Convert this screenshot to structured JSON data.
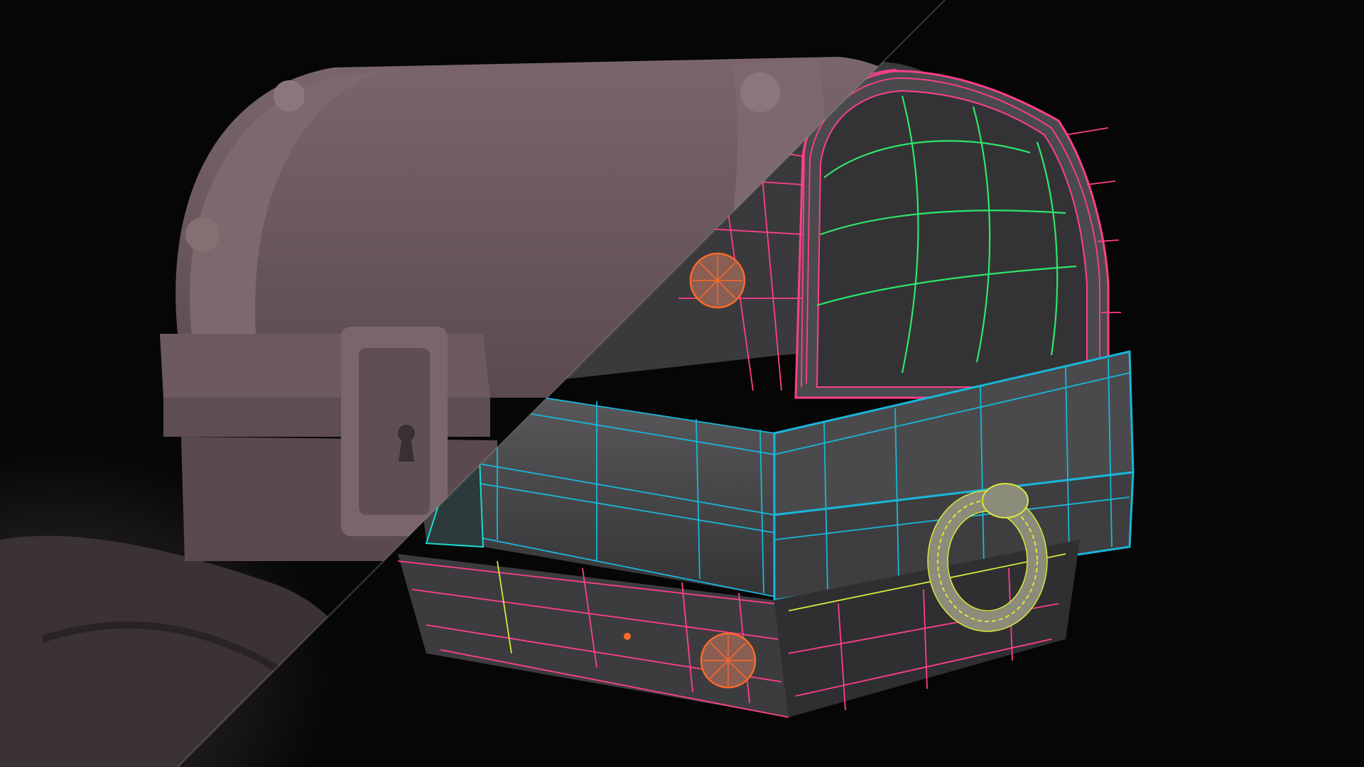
{
  "scene": {
    "subject": "treasure-chest",
    "render_halves": [
      "clay-render",
      "wireframe-topology-render"
    ],
    "colors": {
      "background": "#060606",
      "floor": "#2b2628",
      "clay_dark": "#4f4144",
      "clay_mid": "#6e5c60",
      "clay_light": "#8a7579",
      "grey_dark": "#2c2c2e",
      "grey_mid": "#4a4a4c",
      "grey_light": "#6d6d70",
      "wire_pink": "#ff3f8c",
      "wire_cyan": "#19b6d9",
      "wire_green": "#2ee66a",
      "wire_yellow": "#d9e83a",
      "wire_orange": "#ff6a2a"
    }
  }
}
